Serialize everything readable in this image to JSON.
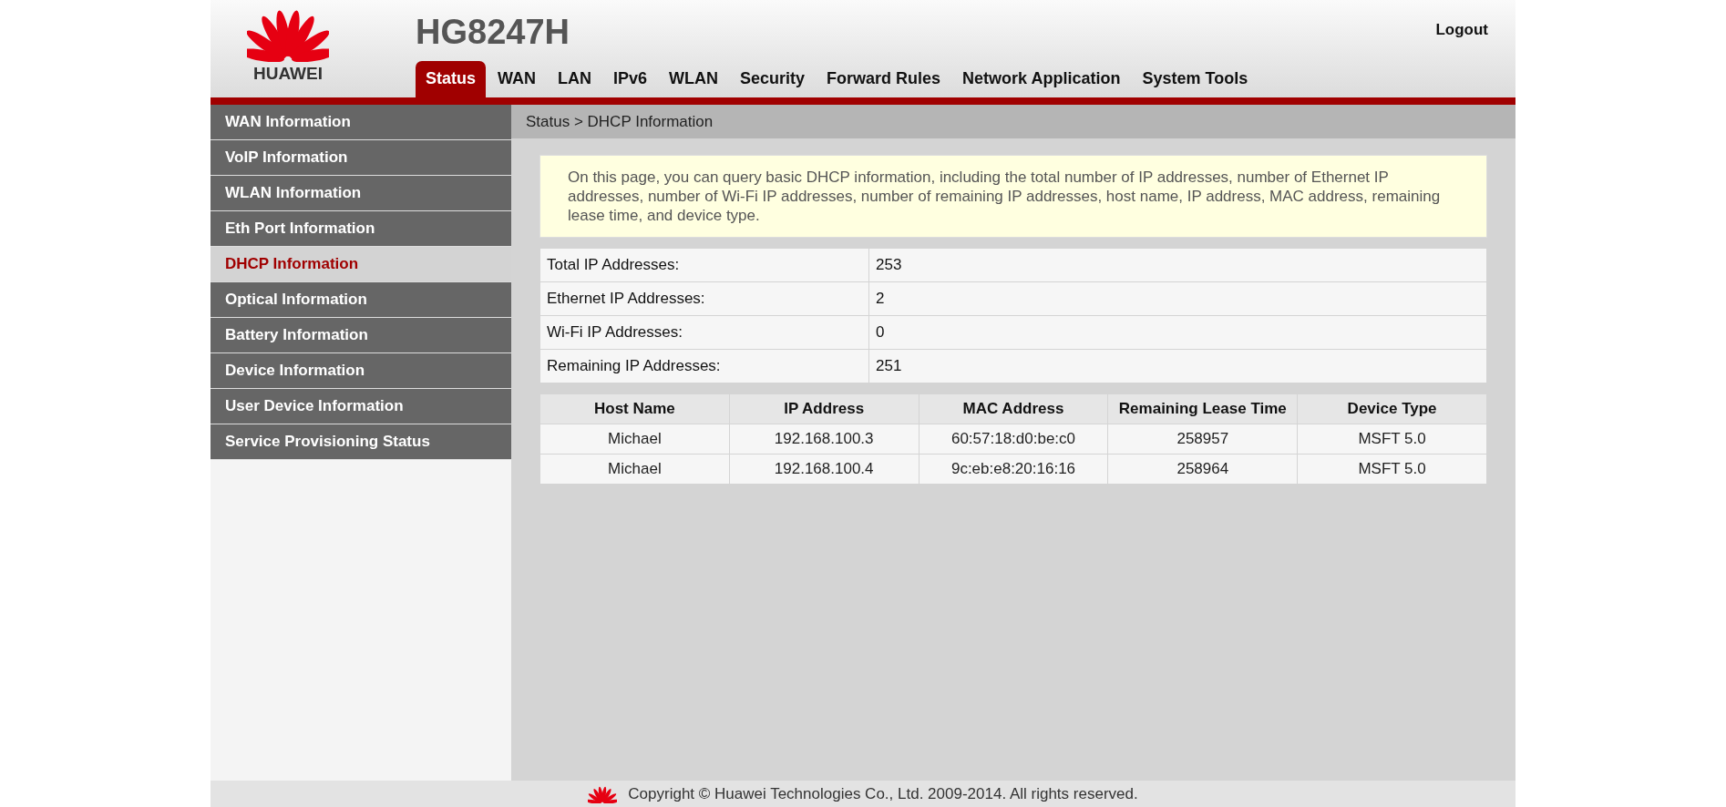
{
  "header": {
    "logo_text": "HUAWEI",
    "model": "HG8247H",
    "logout": "Logout"
  },
  "tabs": [
    {
      "label": "Status",
      "selected": true
    },
    {
      "label": "WAN",
      "selected": false
    },
    {
      "label": "LAN",
      "selected": false
    },
    {
      "label": "IPv6",
      "selected": false
    },
    {
      "label": "WLAN",
      "selected": false
    },
    {
      "label": "Security",
      "selected": false
    },
    {
      "label": "Forward Rules",
      "selected": false
    },
    {
      "label": "Network Application",
      "selected": false
    },
    {
      "label": "System Tools",
      "selected": false
    }
  ],
  "sidebar": {
    "items": [
      {
        "label": "WAN Information",
        "selected": false
      },
      {
        "label": "VoIP Information",
        "selected": false
      },
      {
        "label": "WLAN Information",
        "selected": false
      },
      {
        "label": "Eth Port Information",
        "selected": false
      },
      {
        "label": "DHCP Information",
        "selected": true
      },
      {
        "label": "Optical Information",
        "selected": false
      },
      {
        "label": "Battery Information",
        "selected": false
      },
      {
        "label": "Device Information",
        "selected": false
      },
      {
        "label": "User Device Information",
        "selected": false
      },
      {
        "label": "Service Provisioning Status",
        "selected": false
      }
    ]
  },
  "breadcrumb": "Status > DHCP Information",
  "info": "On this page, you can query basic DHCP information, including the total number of IP addresses, number of Ethernet IP addresses, number of Wi-Fi IP addresses, number of remaining IP addresses, host name, IP address, MAC address, remaining lease time, and device type.",
  "summary": [
    {
      "label": "Total IP Addresses:",
      "value": "253"
    },
    {
      "label": "Ethernet IP Addresses:",
      "value": "2"
    },
    {
      "label": "Wi-Fi IP Addresses:",
      "value": "0"
    },
    {
      "label": "Remaining IP Addresses:",
      "value": "251"
    }
  ],
  "table": {
    "columns": [
      "Host Name",
      "IP Address",
      "MAC Address",
      "Remaining Lease Time",
      "Device Type"
    ],
    "rows": [
      [
        "Michael",
        "192.168.100.3",
        "60:57:18:d0:be:c0",
        "258957",
        "MSFT 5.0"
      ],
      [
        "Michael",
        "192.168.100.4",
        "9c:eb:e8:20:16:16",
        "258964",
        "MSFT 5.0"
      ]
    ]
  },
  "footer": "Copyright © Huawei Technologies Co., Ltd. 2009-2014. All rights reserved."
}
